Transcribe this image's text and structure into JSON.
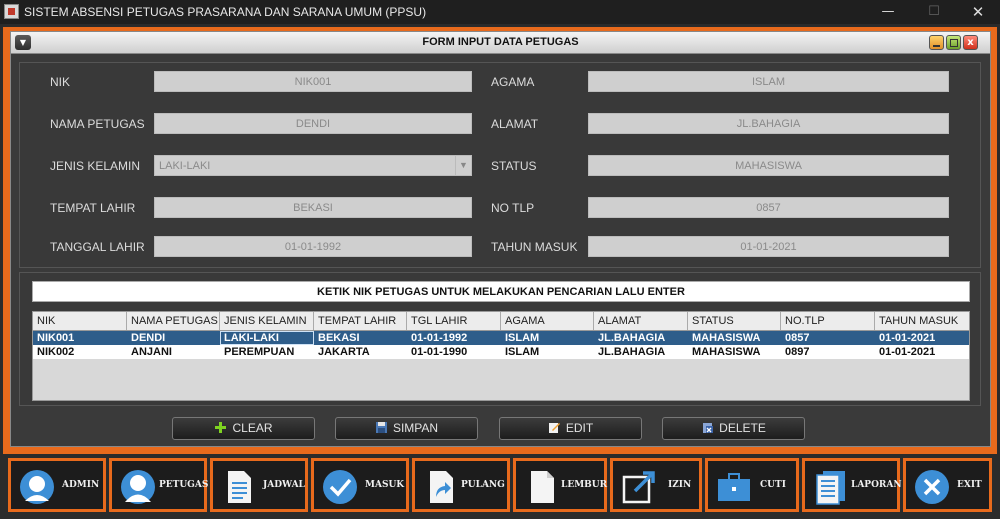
{
  "window": {
    "title": "SISTEM ABSENSI PETUGAS PRASARANA DAN SARANA UMUM (PPSU)",
    "min_glyph": "—",
    "max_glyph": "☐",
    "close_glyph": "✕"
  },
  "internal_frame": {
    "title": "FORM INPUT DATA PETUGAS",
    "close_glyph": "x"
  },
  "form": {
    "nik": {
      "label": "NIK",
      "value": "NIK001"
    },
    "nama": {
      "label": "NAMA PETUGAS",
      "value": "DENDI"
    },
    "jenis_kelamin": {
      "label": "JENIS KELAMIN",
      "value": "LAKI-LAKI"
    },
    "tempat_lahir": {
      "label": "TEMPAT LAHIR",
      "value": "BEKASI"
    },
    "tanggal_lahir": {
      "label": "TANGGAL LAHIR",
      "value": "01-01-1992"
    },
    "agama": {
      "label": "AGAMA",
      "value": "ISLAM"
    },
    "alamat": {
      "label": "ALAMAT",
      "value": "JL.BAHAGIA"
    },
    "status": {
      "label": "STATUS",
      "value": "MAHASISWA"
    },
    "no_tlp": {
      "label": "NO TLP",
      "value": "0857"
    },
    "tahun_masuk": {
      "label": "TAHUN MASUK",
      "value": "01-01-2021"
    }
  },
  "search": {
    "text": "KETIK NIK PETUGAS UNTUK MELAKUKAN PENCARIAN LALU ENTER"
  },
  "table": {
    "headers": [
      "NIK",
      "NAMA PETUGAS",
      "JENIS KELAMIN",
      "TEMPAT LAHIR",
      "TGL LAHIR",
      "AGAMA",
      "ALAMAT",
      "STATUS",
      "NO.TLP",
      "TAHUN MASUK"
    ],
    "rows": [
      [
        "NIK001",
        "DENDI",
        "LAKI-LAKI",
        "BEKASI",
        "01-01-1992",
        "ISLAM",
        "JL.BAHAGIA",
        "MAHASISWA",
        "0857",
        "01-01-2021"
      ],
      [
        "NIK002",
        "ANJANI",
        "PEREMPUAN",
        "JAKARTA",
        "01-01-1990",
        "ISLAM",
        "JL.BAHAGIA",
        "MAHASISWA",
        "0897",
        "01-01-2021"
      ]
    ]
  },
  "actions": {
    "clear": "CLEAR",
    "simpan": "SIMPAN",
    "edit": "EDIT",
    "delete": "DELETE"
  },
  "nav": {
    "admin": "ADMIN",
    "petugas": "PETUGAS",
    "jadwal": "JADWAL",
    "masuk": "MASUK",
    "pulang": "PULANG",
    "lembur": "LEMBUR",
    "izin": "IZIN",
    "cuti": "CUTI",
    "laporan": "LAPORAN",
    "exit": "EXIT"
  },
  "colors": {
    "accent": "#e86a1c",
    "selected_row": "#2e5d8a",
    "panel": "#3a3a3a"
  }
}
